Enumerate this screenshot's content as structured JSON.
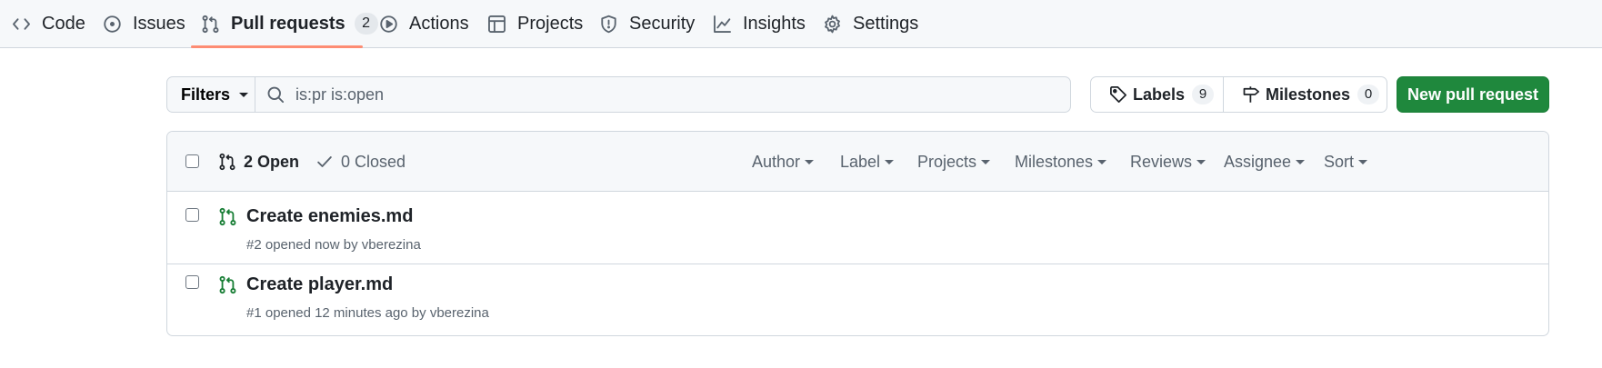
{
  "repo_nav": {
    "tabs": [
      {
        "label": "Code",
        "icon": "code-icon"
      },
      {
        "label": "Issues",
        "icon": "issue-opened-icon"
      },
      {
        "label": "Pull requests",
        "icon": "git-pull-request-icon",
        "counter": "2",
        "selected": true
      },
      {
        "label": "Actions",
        "icon": "play-icon"
      },
      {
        "label": "Projects",
        "icon": "table-icon"
      },
      {
        "label": "Security",
        "icon": "shield-icon"
      },
      {
        "label": "Insights",
        "icon": "graph-icon"
      },
      {
        "label": "Settings",
        "icon": "gear-icon"
      }
    ]
  },
  "subnav": {
    "filters_label": "Filters",
    "search_value": "is:pr is:open",
    "labels_label": "Labels",
    "labels_count": "9",
    "milestones_label": "Milestones",
    "milestones_count": "0",
    "new_pr_label": "New pull request"
  },
  "list_header": {
    "open_label": "2 Open",
    "closed_label": "0 Closed",
    "filters": [
      "Author",
      "Label",
      "Projects",
      "Milestones",
      "Reviews",
      "Assignee",
      "Sort"
    ]
  },
  "pull_requests": [
    {
      "title": "Create enemies.md",
      "meta": "#2 opened now by vberezina"
    },
    {
      "title": "Create player.md",
      "meta": "#1 opened 12 minutes ago by vberezina"
    }
  ],
  "colors": {
    "accent_underline": "#fd8c73",
    "primary_button": "#1f883d",
    "open_pr_icon": "#1a7f37"
  }
}
